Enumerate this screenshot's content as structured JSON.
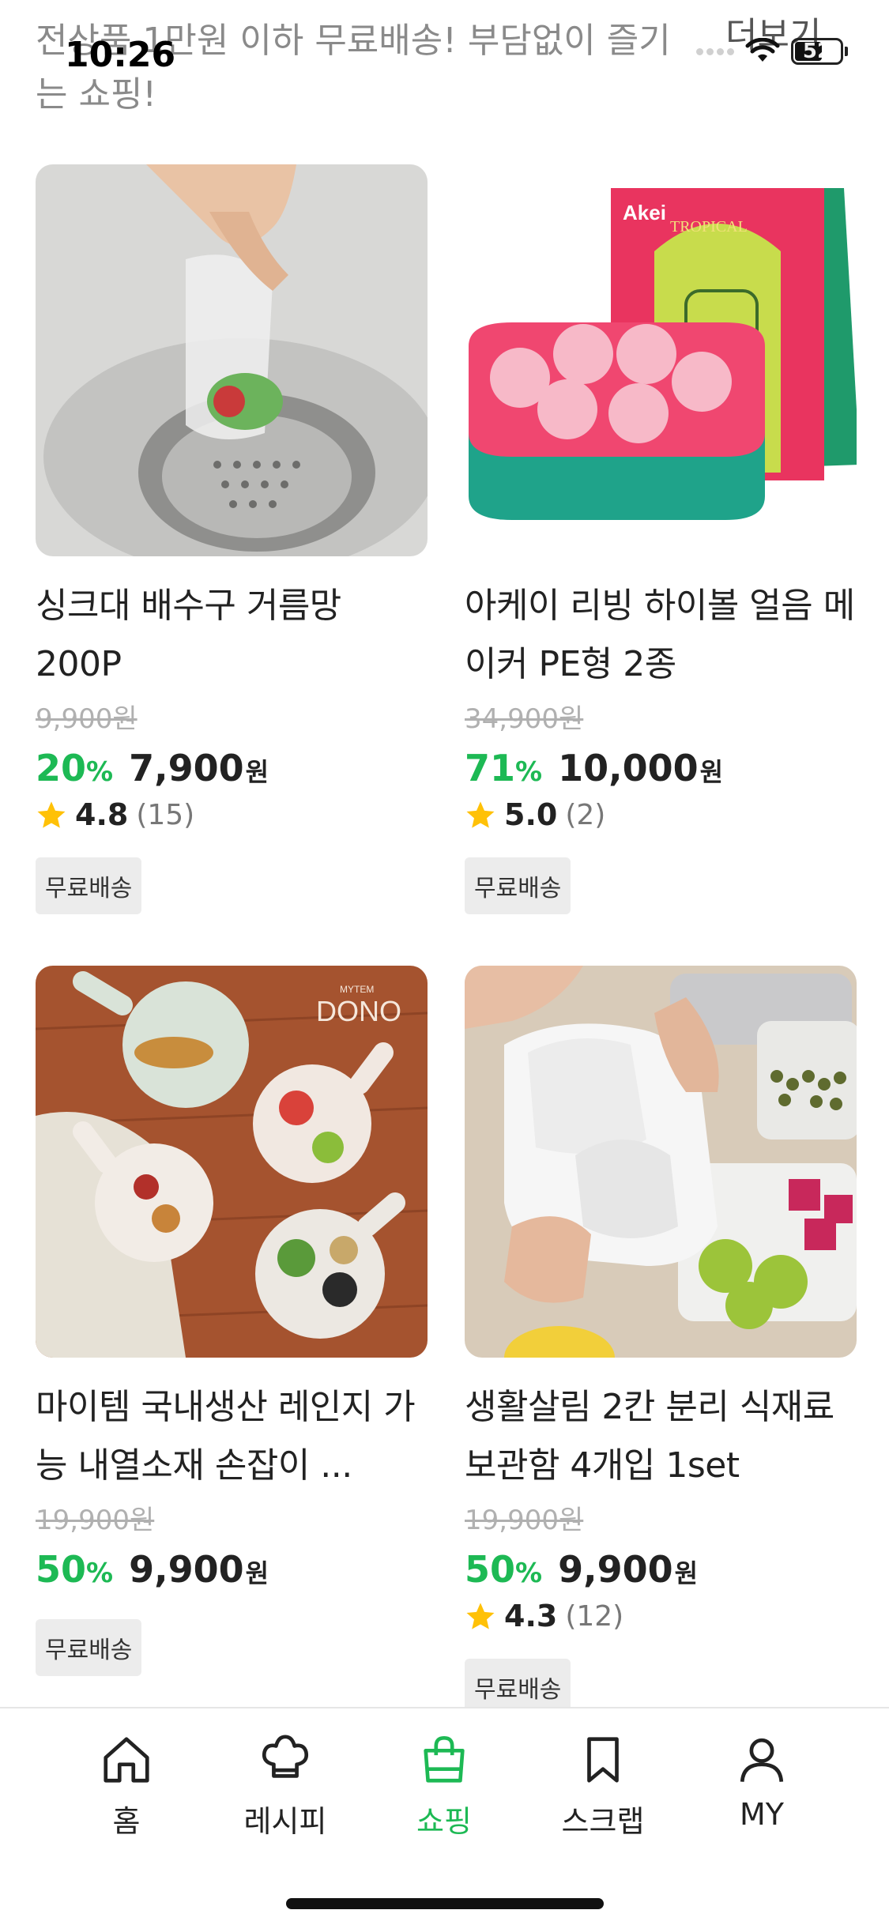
{
  "status_bar": {
    "time": "10:26",
    "battery": "52"
  },
  "header": {
    "promo_text": "전상품 1만원 이하 무료배송! 부담없이 즐기는 쇼핑!",
    "more_label": "더보기"
  },
  "products": [
    {
      "name": "싱크대 배수구 거름망 200P",
      "original_price": "9,900원",
      "discount": "20",
      "price": "7,900",
      "rating": "4.8",
      "review_count": "(15)",
      "badge": "무료배송"
    },
    {
      "name": "아케이 리빙 하이볼 얼음 메이커 PE형 2종",
      "original_price": "34,900원",
      "discount": "71",
      "price": "10,000",
      "rating": "5.0",
      "review_count": "(2)",
      "badge": "무료배송"
    },
    {
      "name": "마이템 국내생산 레인지 가능 내열소재 손잡이 ...",
      "original_price": "19,900원",
      "discount": "50",
      "price": "9,900",
      "badge": "무료배송"
    },
    {
      "name": "생활살림 2칸 분리 식재료 보관함 4개입 1set",
      "original_price": "19,900원",
      "discount": "50",
      "price": "9,900",
      "rating": "4.3",
      "review_count": "(12)",
      "badge": "무료배송"
    }
  ],
  "common": {
    "percent_sign": "%",
    "won_unit": "원"
  },
  "tab_bar": {
    "items": [
      {
        "label": "홈",
        "icon": "home-icon"
      },
      {
        "label": "레시피",
        "icon": "chef-hat-icon"
      },
      {
        "label": "쇼핑",
        "icon": "shopping-bag-icon",
        "active": true
      },
      {
        "label": "스크랩",
        "icon": "bookmark-icon"
      },
      {
        "label": "MY",
        "icon": "person-icon"
      }
    ]
  },
  "colors": {
    "accent": "#1db954",
    "star": "#ffc107",
    "badge_bg": "#ececec"
  },
  "image_text": {
    "box_brand": "Akei",
    "box_title": "TROPICAL",
    "plate_logo": "DONO",
    "plate_brand": "MYTEM"
  }
}
